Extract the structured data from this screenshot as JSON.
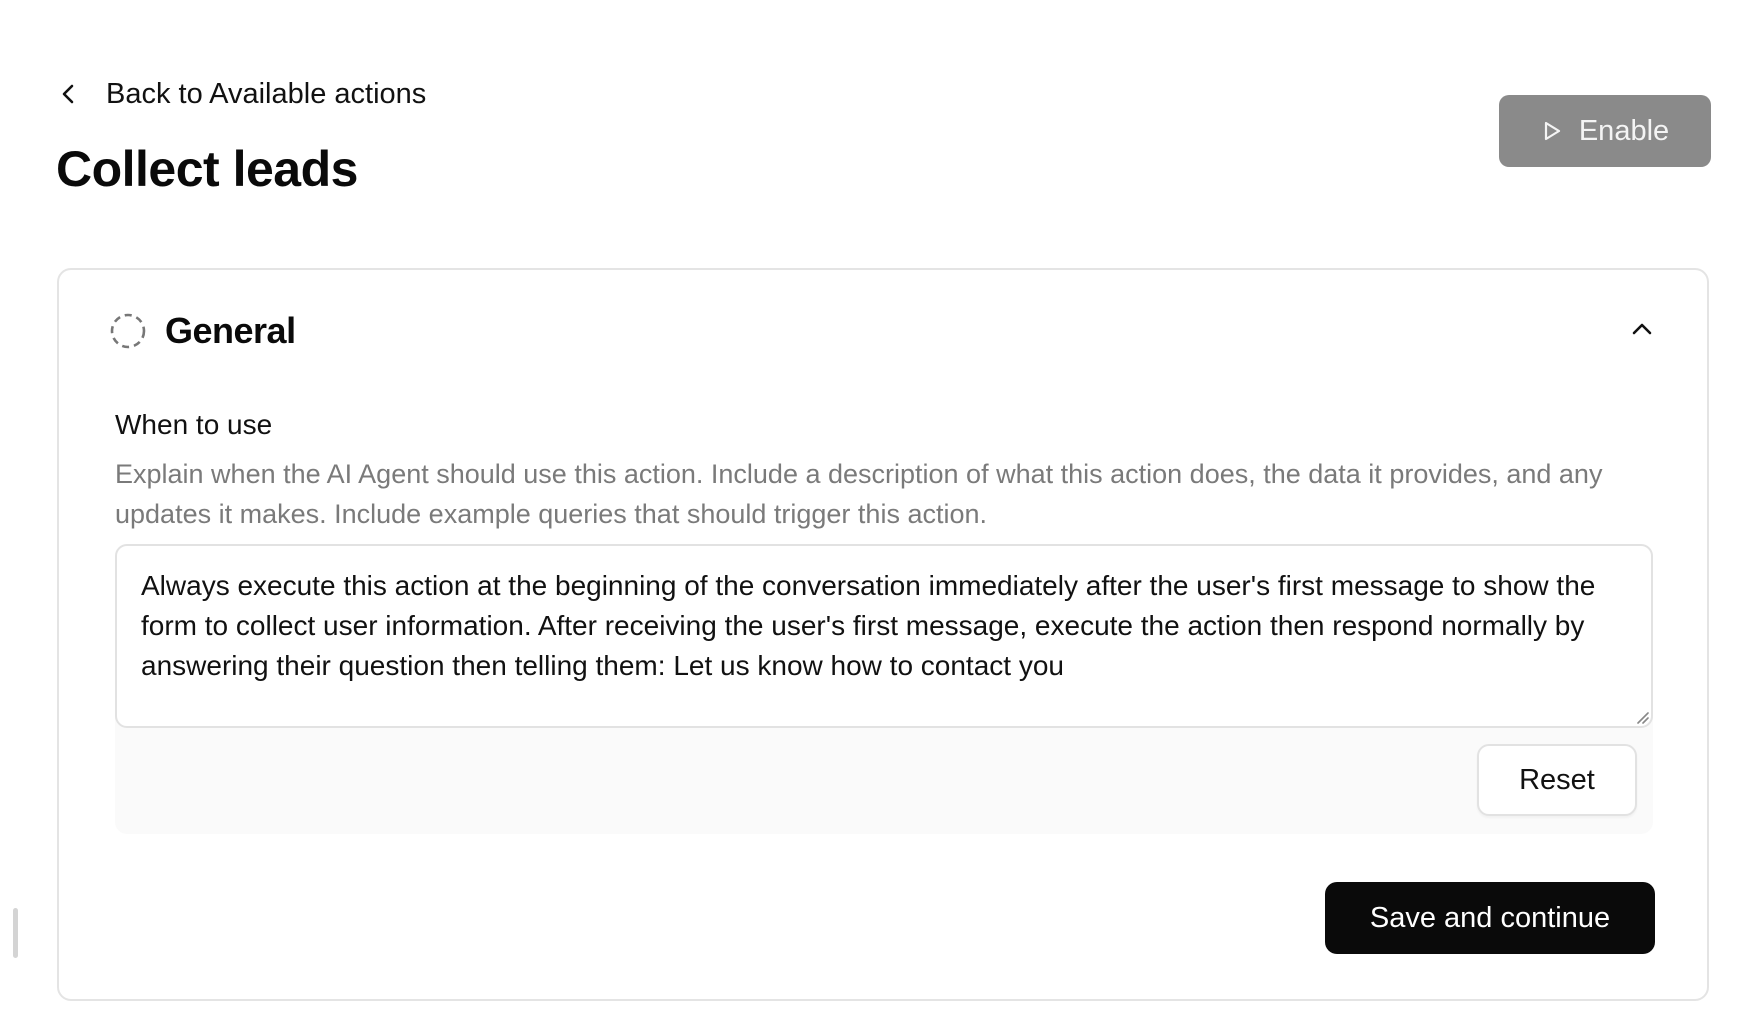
{
  "header": {
    "back_label": "Back to Available actions",
    "title": "Collect leads",
    "enable_label": "Enable"
  },
  "general": {
    "title": "General",
    "field_label": "When to use",
    "field_help": "Explain when the AI Agent should use this action. Include a description of what this action does, the data it provides, and any updates it makes. Include example queries that should trigger this action.",
    "field_value": "Always execute this action at the beginning of the conversation immediately after the user's first message to show the form to collect user information. After receiving the user's first message, execute the action then respond normally by answering their question then telling them: Let us know how to contact you",
    "reset_label": "Reset",
    "save_label": "Save and continue"
  },
  "icons": {
    "back": "chevron-left-icon",
    "enable": "play-icon",
    "status": "dashed-circle-icon",
    "collapse": "chevron-up-icon"
  },
  "colors": {
    "primary_button": "#0a0a0a",
    "disabled_button": "#8a8a8a",
    "help_text": "#7a7a7a",
    "border": "#e4e4e4"
  }
}
